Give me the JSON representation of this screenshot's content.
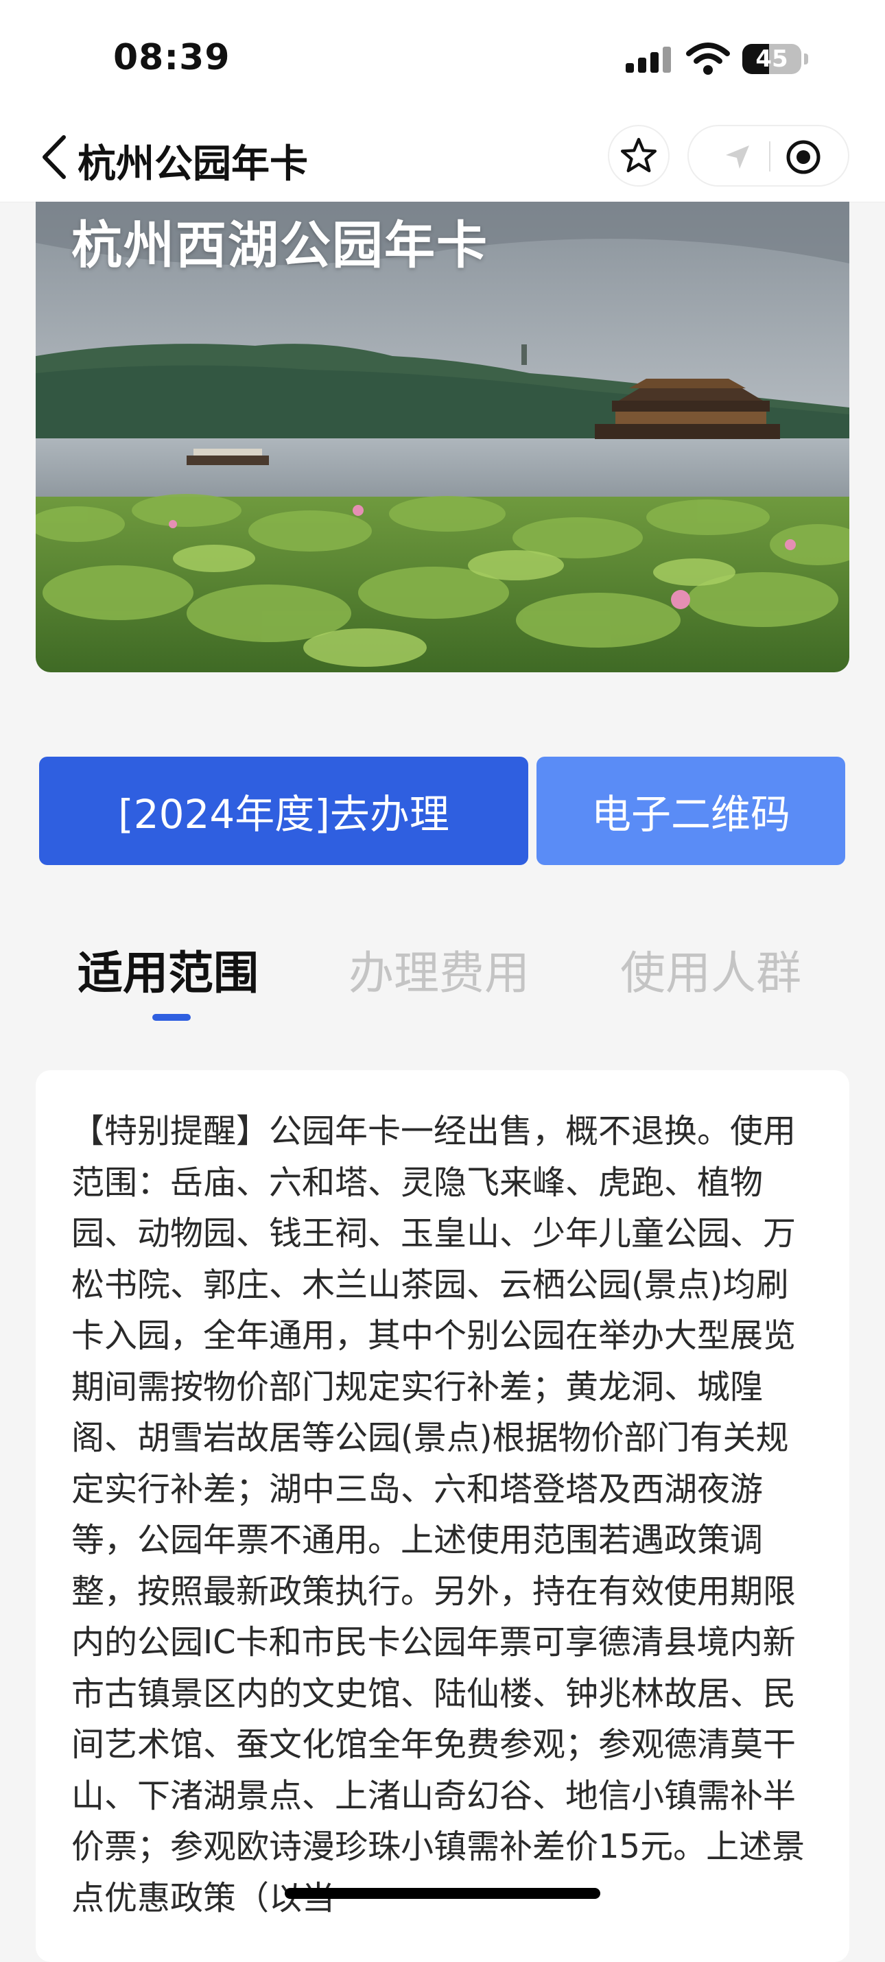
{
  "status_bar": {
    "time": "08:39",
    "battery": "45"
  },
  "nav": {
    "title": "杭州公园年卡",
    "back_icon": "chevron-left-icon",
    "star_icon": "star-icon",
    "location_icon": "location-arrow-icon",
    "record_icon": "record-icon"
  },
  "banner": {
    "title": "杭州西湖公园年卡"
  },
  "actions": {
    "apply_label": "[2024年度]去办理",
    "qr_label": "电子二维码"
  },
  "tabs": [
    {
      "label": "适用范围",
      "active": true
    },
    {
      "label": "办理费用",
      "active": false
    },
    {
      "label": "使用人群",
      "active": false
    }
  ],
  "content": {
    "text": "【特别提醒】公园年卡一经出售，概不退换。使用范围：岳庙、六和塔、灵隐飞来峰、虎跑、植物园、动物园、钱王祠、玉皇山、少年儿童公园、万松书院、郭庄、木兰山茶园、云栖公园(景点)均刷卡入园，全年通用，其中个别公园在举办大型展览期间需按物价部门规定实行补差；黄龙洞、城隍阁、胡雪岩故居等公园(景点)根据物价部门有关规定实行补差；湖中三岛、六和塔登塔及西湖夜游等，公园年票不通用。上述使用范围若遇政策调整，按照最新政策执行。另外，持在有效使用期限内的公园IC卡和市民卡公园年票可享德清县境内新市古镇景区内的文史馆、陆仙楼、钟兆林故居、民间艺术馆、蚕文化馆全年免费参观；参观德清莫干山、下渚湖景点、上渚山奇幻谷、地信小镇需补半价票；参观欧诗漫珍珠小镇需补差价15元。上述景点优惠政策（以当"
  },
  "colors": {
    "primary": "#2f5fe0",
    "secondary": "#5a8cf6",
    "tab_inactive": "#c4c4c4"
  }
}
